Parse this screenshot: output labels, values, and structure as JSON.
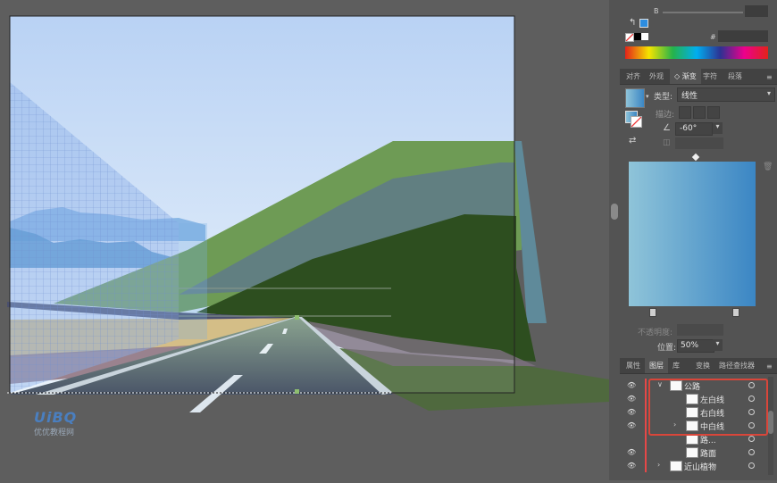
{
  "color_panel": {
    "channel_label": "B",
    "hex_label": "#",
    "hex_value": ""
  },
  "tabs_top": [
    {
      "label": "对齐"
    },
    {
      "label": "外观"
    },
    {
      "label": "◇ 渐变"
    },
    {
      "label": "字符"
    },
    {
      "label": "段落"
    }
  ],
  "gradient": {
    "type_label": "类型:",
    "type_value": "线性",
    "stroke_label": "描边:",
    "angle_value": "-60°",
    "opacity_label": "不透明度:",
    "opacity_value": "",
    "position_label": "位置:",
    "position_value": "50%",
    "start_color": "#8fc4d9",
    "end_color": "#3b86c4"
  },
  "tabs_bottom": [
    {
      "label": "属性"
    },
    {
      "label": "图层"
    },
    {
      "label": "库"
    },
    {
      "label": "变换"
    },
    {
      "label": "路径查找器"
    }
  ],
  "layers": [
    {
      "name": "公路"
    },
    {
      "name": "左白线"
    },
    {
      "name": "右白线"
    },
    {
      "name": "中白线"
    },
    {
      "name": "路..."
    },
    {
      "name": "路面"
    },
    {
      "name": "近山植物"
    }
  ],
  "watermark": {
    "logo": "UiBQ",
    "text": "优优教程网"
  },
  "colors": {
    "highlight_box": "#d9463a",
    "road": "#4a5466",
    "grass_dark": "#2f4f1f",
    "grass_light": "#6f9a54"
  }
}
